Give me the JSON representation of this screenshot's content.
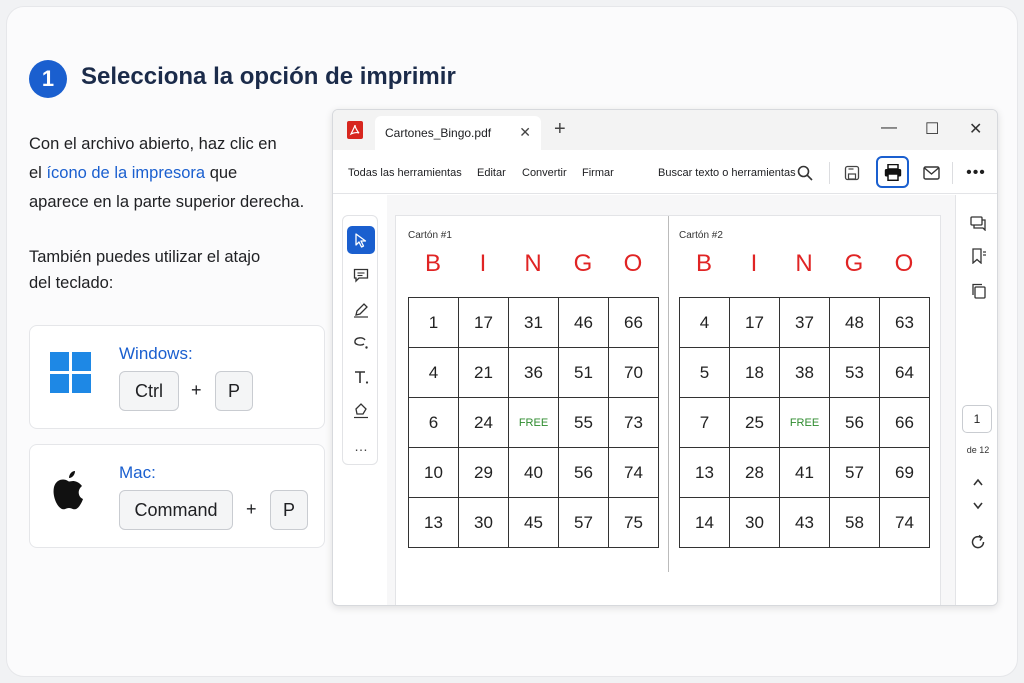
{
  "step": {
    "number": "1",
    "title": "Selecciona la opción de imprimir"
  },
  "intro": {
    "line1": "Con el archivo abierto, haz clic en",
    "line2_pre": "el ",
    "line2_highlight": "ícono de la impresora",
    "line2_post": " que",
    "line3": "aparece en la parte superior derecha."
  },
  "shortcut_intro": {
    "line1": "También puedes utilizar el atajo",
    "line2": "del teclado:"
  },
  "windows": {
    "label": "Windows:",
    "key1": "Ctrl",
    "plus": "+",
    "key2": "P"
  },
  "mac": {
    "label": "Mac:",
    "key1": "Command",
    "plus": "+",
    "key2": "P"
  },
  "app": {
    "tab_title": "Cartones_Bingo.pdf",
    "toolbar": {
      "all_tools": "Todas las herramientas",
      "edit": "Editar",
      "convert": "Convertir",
      "sign": "Firmar",
      "search": "Buscar texto o herramientas"
    },
    "page_number": "1",
    "page_total": "de 12"
  },
  "colors": {
    "accent": "#1a5fcf",
    "bingo_red": "#e02424",
    "free_green": "#2e8b2e",
    "windows_blue": "#1e88e5"
  },
  "bingo": {
    "letters": [
      "B",
      "I",
      "N",
      "G",
      "O"
    ],
    "free_label": "FREE",
    "cards": [
      {
        "label": "Cartón #1",
        "rows": [
          [
            "1",
            "17",
            "31",
            "46",
            "66"
          ],
          [
            "4",
            "21",
            "36",
            "51",
            "70"
          ],
          [
            "6",
            "24",
            "FREE",
            "55",
            "73"
          ],
          [
            "10",
            "29",
            "40",
            "56",
            "74"
          ],
          [
            "13",
            "30",
            "45",
            "57",
            "75"
          ]
        ]
      },
      {
        "label": "Cartón #2",
        "rows": [
          [
            "4",
            "17",
            "37",
            "48",
            "63"
          ],
          [
            "5",
            "18",
            "38",
            "53",
            "64"
          ],
          [
            "7",
            "25",
            "FREE",
            "56",
            "66"
          ],
          [
            "13",
            "28",
            "41",
            "57",
            "69"
          ],
          [
            "14",
            "30",
            "43",
            "58",
            "74"
          ]
        ]
      }
    ]
  }
}
